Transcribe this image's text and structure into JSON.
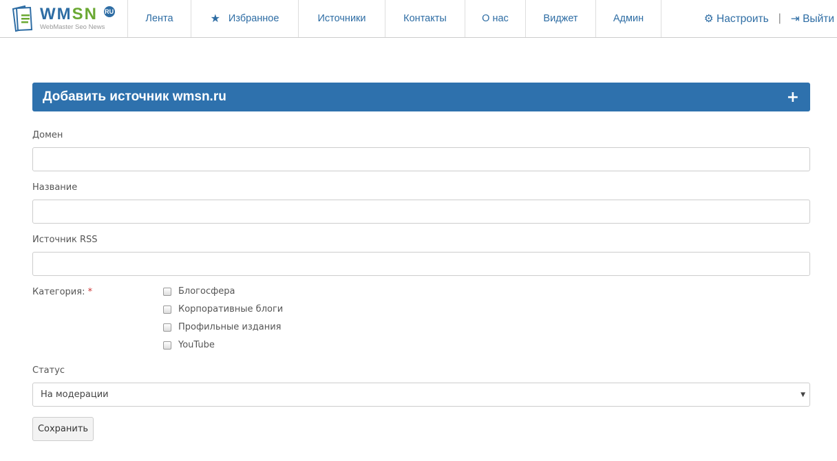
{
  "logo": {
    "main": "WMSN",
    "badge": "RU",
    "sub": "WebMaster Seo News"
  },
  "nav": [
    {
      "label": "Лента"
    },
    {
      "label": "Избранное",
      "icon": "star-icon"
    },
    {
      "label": "Источники"
    },
    {
      "label": "Контакты"
    },
    {
      "label": "О нас"
    },
    {
      "label": "Виджет"
    },
    {
      "label": "Админ"
    }
  ],
  "user": {
    "settings": "Настроить",
    "logout": "Выйти",
    "separator": "|"
  },
  "panel": {
    "title": "Добавить источник wmsn.ru",
    "plus": "+"
  },
  "form": {
    "domain_label": "Домен",
    "domain_value": "",
    "name_label": "Название",
    "name_value": "",
    "rss_label": "Источник RSS",
    "rss_value": "",
    "category_label": "Категория:",
    "required_mark": "*",
    "categories": [
      "Блогосфера",
      "Корпоративные блоги",
      "Профильные издания",
      "YouTube"
    ],
    "status_label": "Статус",
    "status_value": "На модерации",
    "save": "Сохранить"
  },
  "colors": {
    "brand": "#2e71ad",
    "green": "#6aa832"
  }
}
